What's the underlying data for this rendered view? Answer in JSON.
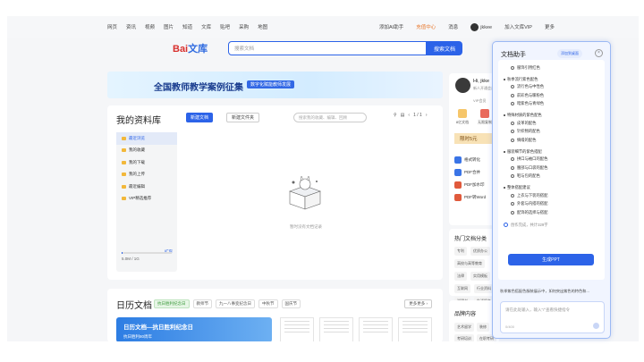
{
  "topnav": {
    "left": [
      "网页",
      "资讯",
      "视频",
      "图片",
      "知道",
      "文库",
      "贴吧",
      "采购",
      "地图"
    ],
    "right": {
      "assistant": "添加AI助手",
      "vip_center": "充值中心",
      "messages": "消息",
      "user": "jkkee",
      "join_vip": "加入文库VIP",
      "more": "更多"
    }
  },
  "search": {
    "logo_a": "Bai",
    "logo_b": "文库",
    "placeholder": "搜索文档",
    "button": "搜索文档"
  },
  "banner": {
    "title": "全国教师教学案例征集",
    "badge": "数字化赋能教师发展"
  },
  "library": {
    "title": "我的资料库",
    "new_doc": "新建文档",
    "new_folder": "新建文件夹",
    "search_placeholder": "搜索我的收藏、编辑、回顾",
    "pager": "1 / 1",
    "tree": [
      "最近浏览",
      "我的收藏",
      "我的下载",
      "我的上传",
      "最近编辑",
      "VIP精选推荐"
    ],
    "storage": "5.0M / 1G",
    "storage_fraction": 0.01,
    "expand": "扩容",
    "empty_text": "暂时没有文档记录"
  },
  "history": {
    "title": "日历文档",
    "tags": [
      "抗日胜利纪念日",
      "教师节",
      "九一八事变纪念日",
      "中秋节",
      "国庆节"
    ],
    "more": "更多更多 ›",
    "banner_title": "日历文档—抗日胜利纪念日",
    "banner_sub": "抗日胜利80周年"
  },
  "profile": {
    "name": "Hi, jkke",
    "sub": "新人开通会员",
    "vip": "VIP会员",
    "icons": [
      "8亿文档",
      "无限复制",
      "…"
    ],
    "limited": "限时5元",
    "tools": [
      "格式转化",
      "PDF合并",
      "PDF加水印",
      "PDF转Word"
    ]
  },
  "categories": {
    "title": "热门文档分类",
    "items": [
      "专利",
      "优质办公",
      "高校与高等教育",
      "法律",
      "实用模板",
      "互联网",
      "行业资料",
      "说明书",
      "生活服务"
    ]
  },
  "brand": {
    "title": "品牌内容",
    "items": [
      "艺术留学",
      "装修",
      "考研培训",
      "在职考研"
    ]
  },
  "assistant": {
    "title": "文档助手",
    "badge": "添加到桌面",
    "close": "×",
    "content_top": "服饰引用红色",
    "sections": [
      {
        "h": "秋季流行紫色配色",
        "s": [
          "流行色与中性色",
          "前彩色与暖粉色",
          "暗紫色与青绿色"
        ]
      },
      {
        "h": "特殊材质的紫色配色",
        "s": [
          "皮革的配色",
          "针织物的配色",
          "绸缎的配色"
        ]
      },
      {
        "h": "服装细节的紫色搭配",
        "s": [
          "拼口与袖口的配色",
          "腰部与口袋的配色",
          "鞋与包的配色"
        ]
      },
      {
        "h": "整体搭配建议",
        "s": [
          "上衣与下装的搭配",
          "外套与内搭的搭配",
          "配饰的选择与搭配"
        ]
      }
    ],
    "done": "创作完成，共计329字",
    "ppt_button": "生成PPT",
    "note": "秋季紫色搭配色服装展示中，如何突出紫色的特色和...",
    "input_placeholder": "请在此处输入，输入\"/\"查看快捷指令",
    "count": "0/400"
  }
}
